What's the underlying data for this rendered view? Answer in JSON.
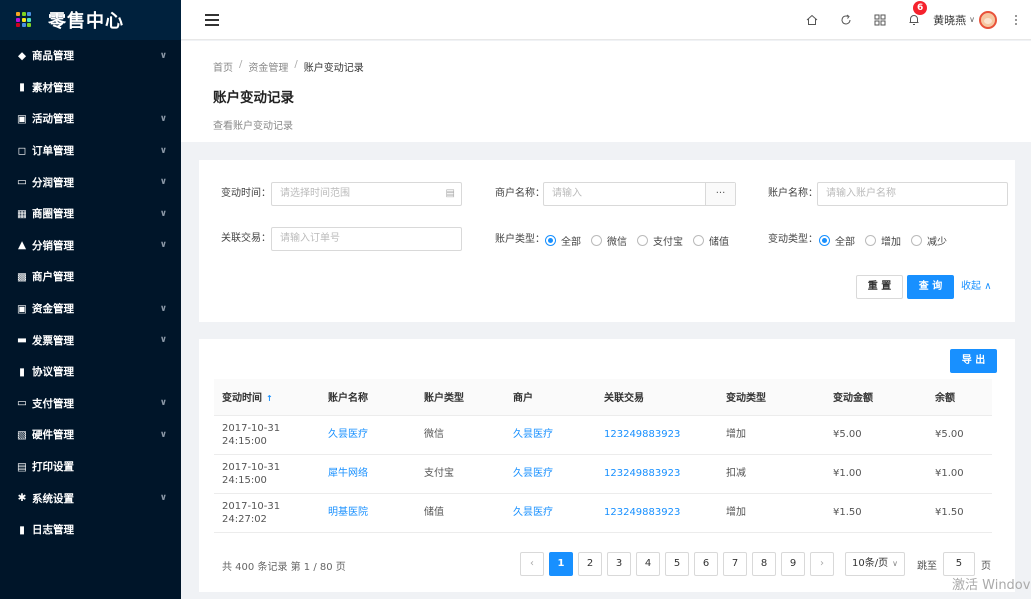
{
  "app": {
    "title": "零售中心"
  },
  "brand": {
    "sidebar_bg": "#001529",
    "primary": "#1890ff",
    "badge": "#f5222d"
  },
  "sidebar": {
    "items": [
      {
        "label": "商品管理",
        "icon": "tag-icon",
        "chevron": true
      },
      {
        "label": "素材管理",
        "icon": "file-icon",
        "chevron": false
      },
      {
        "label": "活动管理",
        "icon": "calendar-icon",
        "chevron": true
      },
      {
        "label": "订单管理",
        "icon": "order-icon",
        "chevron": true
      },
      {
        "label": "分润管理",
        "icon": "monitor-icon",
        "chevron": true
      },
      {
        "label": "商圈管理",
        "icon": "apps-icon",
        "chevron": true
      },
      {
        "label": "分销管理",
        "icon": "home-icon",
        "chevron": true
      },
      {
        "label": "商户管理",
        "icon": "merchant-icon",
        "chevron": false
      },
      {
        "label": "资金管理",
        "icon": "wallet-icon",
        "chevron": true
      },
      {
        "label": "发票管理",
        "icon": "invoice-icon",
        "chevron": true
      },
      {
        "label": "协议管理",
        "icon": "document-icon",
        "chevron": false
      },
      {
        "label": "支付管理",
        "icon": "card-icon",
        "chevron": true
      },
      {
        "label": "硬件管理",
        "icon": "hardware-icon",
        "chevron": true
      },
      {
        "label": "打印设置",
        "icon": "printer-icon",
        "chevron": false
      },
      {
        "label": "系统设置",
        "icon": "gear-icon",
        "chevron": true
      },
      {
        "label": "日志管理",
        "icon": "log-icon",
        "chevron": false
      }
    ]
  },
  "header": {
    "notifications": "6",
    "user_name": "黄晓燕"
  },
  "page": {
    "breadcrumb": [
      "首页",
      "资金管理",
      "账户变动记录"
    ],
    "breadcrumb_sep": "/",
    "title": "账户变动记录",
    "subtitle": "查看账户变动记录"
  },
  "filters": {
    "time_label": "变动时间：",
    "time_placeholder": "请选择时间范围",
    "merchant_label": "商户名称：",
    "merchant_placeholder": "请输入",
    "merchant_addon": "···",
    "account_label": "账户名称：",
    "account_placeholder": "请输入账户名称",
    "trade_label": "关联交易：",
    "trade_placeholder": "请输入订单号",
    "account_type_label": "账户类型：",
    "account_type_options": [
      "全部",
      "微信",
      "支付宝",
      "储值"
    ],
    "change_type_label": "变动类型：",
    "change_type_options": [
      "全部",
      "增加",
      "减少"
    ],
    "reset": "重 置",
    "search": "查 询",
    "collapse": "收起"
  },
  "table": {
    "export": "导 出",
    "columns": [
      "变动时间",
      "账户名称",
      "账户类型",
      "商户",
      "关联交易",
      "变动类型",
      "变动金额",
      "余额"
    ],
    "rows": [
      {
        "time_date": "2017-10-31",
        "time_clock": "24:15:00",
        "account": "久昙医疗",
        "type": "微信",
        "merchant": "久昙医疗",
        "trade": "123249883923",
        "change": "增加",
        "amount": "¥5.00",
        "balance": "¥5.00"
      },
      {
        "time_date": "2017-10-31",
        "time_clock": "24:15:00",
        "account": "犀牛网络",
        "type": "支付宝",
        "merchant": "久昙医疗",
        "trade": "123249883923",
        "change": "扣减",
        "amount": "¥1.00",
        "balance": "¥1.00"
      },
      {
        "time_date": "2017-10-31",
        "time_clock": "24:27:02",
        "account": "明基医院",
        "type": "储值",
        "merchant": "久昙医疗",
        "trade": "123249883923",
        "change": "增加",
        "amount": "¥1.50",
        "balance": "¥1.50"
      }
    ]
  },
  "pagination": {
    "total": "共 400 条记录 第 1 / 80 页",
    "pages": [
      "1",
      "2",
      "3",
      "4",
      "5",
      "6",
      "7",
      "8",
      "9"
    ],
    "current": "1",
    "page_size": "10条/页",
    "jump_label": "跳至",
    "jump_value": "5",
    "jump_suffix": "页"
  },
  "watermark": "激活 Windov"
}
